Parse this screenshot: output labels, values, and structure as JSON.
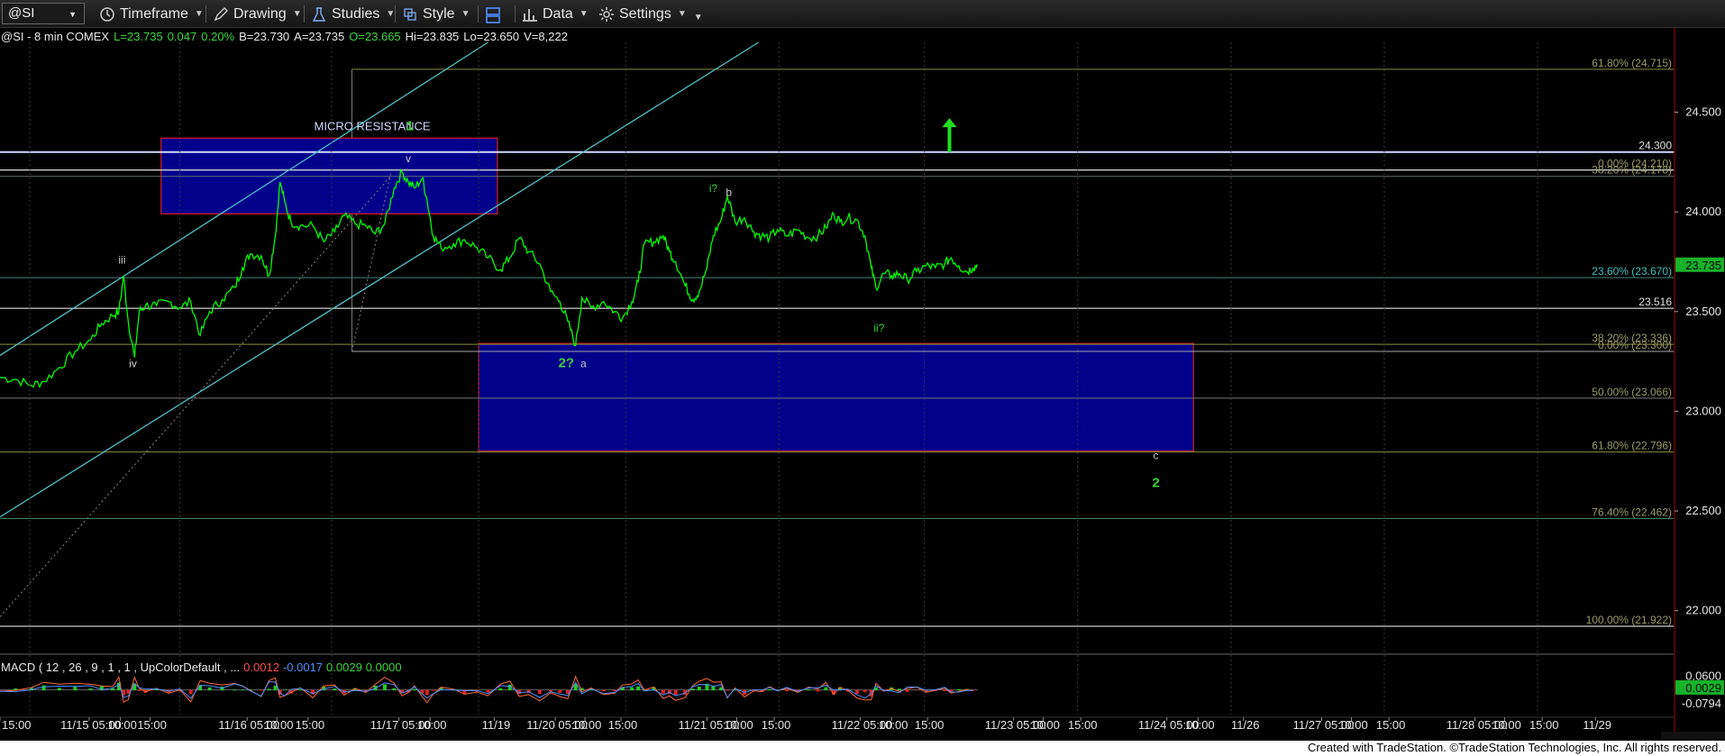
{
  "toolbar": {
    "symbol": "@SI",
    "items": [
      {
        "label": "Timeframe",
        "icon": "clock-icon"
      },
      {
        "label": "Drawing",
        "icon": "pencil-icon"
      },
      {
        "label": "Studies",
        "icon": "flask-icon"
      },
      {
        "label": "Style",
        "icon": "style-icon"
      },
      {
        "label": "",
        "icon": "layout-icon"
      },
      {
        "label": "Data",
        "icon": "bar-chart-icon"
      },
      {
        "label": "Settings",
        "icon": "gear-icon"
      }
    ]
  },
  "header": {
    "symbol": "@SI - 8 min  COMEX",
    "last": "L=23.735",
    "chg": "0.047",
    "pct": "0.20%",
    "bid": "B=23.730",
    "ask": "A=23.735",
    "open": "O=23.665",
    "hi": "Hi=23.835",
    "lo": "Lo=23.650",
    "vol": "V=8,222"
  },
  "macd_header": {
    "title": "MACD ( 12 , 26 , 9 , 1 , 1 , UpColorDefault , ...",
    "v1": "0.0012",
    "v2": "-0.0017",
    "v3": "0.0029",
    "v4": "0.0000"
  },
  "credit": "Created with TradeStation. ©TradeStation Technologies, Inc. All rights reserved.",
  "colors": {
    "price": "#00ff00",
    "box": "#00008b",
    "box_border": "#d02020",
    "channel": "#4fc3c8",
    "fib": "#8a8a40",
    "label_green": "#3bd43b"
  },
  "chart_data": {
    "type": "line",
    "y_axis": {
      "range": [
        21.8,
        24.85
      ],
      "ticks": [
        22.0,
        22.5,
        23.0,
        23.5,
        24.0,
        24.5
      ],
      "tick_labels": [
        "22.000",
        "22.500",
        "23.000",
        "23.500",
        "24.000",
        "24.500"
      ]
    },
    "x_axis": {
      "range": [
        0,
        10.7
      ],
      "ticks": [
        {
          "t": 0.0,
          "label": "15:00"
        },
        {
          "t": 0.57,
          "label": "11/15 05:00"
        },
        {
          "t": 0.77,
          "label": "10:00"
        },
        {
          "t": 0.96,
          "label": "15:00"
        },
        {
          "t": 1.58,
          "label": "11/16 05:00"
        },
        {
          "t": 1.77,
          "label": "10:00"
        },
        {
          "t": 1.97,
          "label": "15:00"
        },
        {
          "t": 2.55,
          "label": "11/17 05:00"
        },
        {
          "t": 2.75,
          "label": "10:00"
        },
        {
          "t": 3.16,
          "label": "11/19"
        },
        {
          "t": 3.55,
          "label": "11/20 05:00"
        },
        {
          "t": 3.74,
          "label": "10:00"
        },
        {
          "t": 3.97,
          "label": "15:00"
        },
        {
          "t": 4.52,
          "label": "11/21 05:00"
        },
        {
          "t": 4.71,
          "label": "10:00"
        },
        {
          "t": 4.95,
          "label": "15:00"
        },
        {
          "t": 5.5,
          "label": "11/22 05:00"
        },
        {
          "t": 5.7,
          "label": "10:00"
        },
        {
          "t": 5.93,
          "label": "15:00"
        },
        {
          "t": 6.48,
          "label": "11/23 05:00"
        },
        {
          "t": 6.67,
          "label": "10:00"
        },
        {
          "t": 6.91,
          "label": "15:00"
        },
        {
          "t": 7.46,
          "label": "11/24 05:00"
        },
        {
          "t": 7.66,
          "label": "10:00"
        },
        {
          "t": 7.95,
          "label": "11/26"
        },
        {
          "t": 8.45,
          "label": "11/27 05:00"
        },
        {
          "t": 8.64,
          "label": "10:00"
        },
        {
          "t": 8.88,
          "label": "15:00"
        },
        {
          "t": 9.43,
          "label": "11/28 05:00"
        },
        {
          "t": 9.62,
          "label": "10:00"
        },
        {
          "t": 9.86,
          "label": "15:00"
        },
        {
          "t": 10.2,
          "label": "11/29"
        }
      ]
    },
    "series": [
      {
        "points": [
          [
            0.0,
            23.17
          ],
          [
            0.1,
            23.16
          ],
          [
            0.2,
            23.13
          ],
          [
            0.28,
            23.15
          ],
          [
            0.38,
            23.22
          ],
          [
            0.48,
            23.3
          ],
          [
            0.58,
            23.36
          ],
          [
            0.65,
            23.44
          ],
          [
            0.72,
            23.48
          ],
          [
            0.76,
            23.5
          ],
          [
            0.79,
            23.68
          ],
          [
            0.82,
            23.45
          ],
          [
            0.86,
            23.27
          ],
          [
            0.89,
            23.5
          ],
          [
            0.93,
            23.53
          ],
          [
            1.0,
            23.53
          ],
          [
            1.08,
            23.55
          ],
          [
            1.15,
            23.52
          ],
          [
            1.22,
            23.55
          ],
          [
            1.28,
            23.38
          ],
          [
            1.34,
            23.5
          ],
          [
            1.42,
            23.56
          ],
          [
            1.5,
            23.62
          ],
          [
            1.55,
            23.72
          ],
          [
            1.6,
            23.79
          ],
          [
            1.67,
            23.78
          ],
          [
            1.72,
            23.68
          ],
          [
            1.76,
            23.88
          ],
          [
            1.79,
            24.15
          ],
          [
            1.82,
            24.05
          ],
          [
            1.86,
            23.95
          ],
          [
            1.92,
            23.93
          ],
          [
            2.0,
            23.93
          ],
          [
            2.07,
            23.85
          ],
          [
            2.14,
            23.9
          ],
          [
            2.2,
            23.98
          ],
          [
            2.27,
            23.94
          ],
          [
            2.34,
            23.93
          ],
          [
            2.4,
            23.89
          ],
          [
            2.46,
            23.94
          ],
          [
            2.52,
            24.12
          ],
          [
            2.57,
            24.2
          ],
          [
            2.61,
            24.15
          ],
          [
            2.65,
            24.12
          ],
          [
            2.7,
            24.17
          ],
          [
            2.73,
            24.06
          ],
          [
            2.77,
            23.88
          ],
          [
            2.82,
            23.82
          ],
          [
            2.9,
            23.84
          ],
          [
            2.97,
            23.86
          ],
          [
            3.05,
            23.82
          ],
          [
            3.12,
            23.77
          ],
          [
            3.2,
            23.71
          ],
          [
            3.26,
            23.77
          ],
          [
            3.32,
            23.87
          ],
          [
            3.38,
            23.8
          ],
          [
            3.45,
            23.74
          ],
          [
            3.52,
            23.6
          ],
          [
            3.58,
            23.55
          ],
          [
            3.63,
            23.45
          ],
          [
            3.68,
            23.33
          ],
          [
            3.72,
            23.57
          ],
          [
            3.78,
            23.52
          ],
          [
            3.86,
            23.55
          ],
          [
            3.93,
            23.5
          ],
          [
            3.98,
            23.47
          ],
          [
            4.04,
            23.55
          ],
          [
            4.08,
            23.65
          ],
          [
            4.12,
            23.84
          ],
          [
            4.18,
            23.85
          ],
          [
            4.24,
            23.88
          ],
          [
            4.28,
            23.8
          ],
          [
            4.32,
            23.75
          ],
          [
            4.38,
            23.63
          ],
          [
            4.43,
            23.56
          ],
          [
            4.47,
            23.6
          ],
          [
            4.52,
            23.72
          ],
          [
            4.56,
            23.88
          ],
          [
            4.61,
            23.96
          ],
          [
            4.65,
            24.08
          ],
          [
            4.7,
            23.95
          ],
          [
            4.76,
            23.97
          ],
          [
            4.82,
            23.9
          ],
          [
            4.87,
            23.88
          ],
          [
            4.92,
            23.87
          ],
          [
            4.97,
            23.91
          ],
          [
            5.03,
            23.88
          ],
          [
            5.1,
            23.91
          ],
          [
            5.17,
            23.87
          ],
          [
            5.23,
            23.88
          ],
          [
            5.28,
            23.92
          ],
          [
            5.33,
            23.99
          ],
          [
            5.37,
            23.95
          ],
          [
            5.42,
            23.97
          ],
          [
            5.48,
            23.96
          ],
          [
            5.53,
            23.88
          ],
          [
            5.57,
            23.72
          ],
          [
            5.6,
            23.62
          ],
          [
            5.65,
            23.69
          ],
          [
            5.7,
            23.68
          ],
          [
            5.75,
            23.69
          ],
          [
            5.8,
            23.66
          ],
          [
            5.86,
            23.7
          ],
          [
            5.92,
            23.73
          ],
          [
            5.98,
            23.72
          ],
          [
            6.04,
            23.74
          ],
          [
            6.08,
            23.77
          ],
          [
            6.13,
            23.73
          ],
          [
            6.18,
            23.7
          ],
          [
            6.22,
            23.72
          ],
          [
            6.25,
            23.735
          ]
        ]
      }
    ],
    "channel_lines": [
      {
        "from": [
          0.0,
          23.28
        ],
        "to": [
          3.12,
          24.85
        ]
      },
      {
        "from": [
          0.0,
          22.47
        ],
        "to": [
          4.85,
          24.85
        ]
      },
      {
        "from": [
          0.0,
          21.97
        ],
        "to": [
          2.5,
          24.18
        ],
        "dotted": true
      }
    ],
    "horizontal_lines": [
      {
        "y": 24.3,
        "label": "24.300",
        "color": "#cfd8ff",
        "width": 2,
        "x0": 0
      },
      {
        "y": 24.21,
        "label": "0.00% (24.210)",
        "color": "#cfcfcf",
        "width": 1.4,
        "x0": 0
      },
      {
        "y": 24.178,
        "label": "38.20% (24.178)",
        "color": "#5f6f6f",
        "width": 1,
        "x0": 0
      },
      {
        "y": 23.67,
        "label": "23.60% (23.670)",
        "color": "#4a7f7f",
        "width": 1,
        "x0": 0
      },
      {
        "y": 23.516,
        "label": "23.516",
        "color": "#bbbbbb",
        "width": 1.4,
        "x0": 0
      },
      {
        "y": 23.336,
        "label": "38.20% (23.336)",
        "color": "#8a8a40",
        "width": 1,
        "x0": 0
      },
      {
        "y": 23.3,
        "label": "0.00% (23.300)",
        "color": "#aaaaaa",
        "width": 1,
        "x0": 2.25
      },
      {
        "y": 23.066,
        "label": "50.00% (23.066)",
        "color": "#777777",
        "width": 1,
        "x0": 0
      },
      {
        "y": 22.796,
        "label": "61.80% (22.796)",
        "color": "#8a8a40",
        "width": 1,
        "x0": 0
      },
      {
        "y": 22.462,
        "label": "76.40% (22.462)",
        "color": "#3f7f5f",
        "width": 1,
        "x0": 0
      },
      {
        "y": 21.922,
        "label": "100.00% (21.922)",
        "color": "#cccccc",
        "width": 1.2,
        "x0": 0
      },
      {
        "y": 24.715,
        "label": "61.80% (24.715)",
        "color": "#8a8a40",
        "width": 1,
        "x0": 2.25
      }
    ],
    "boxes": [
      {
        "x0": 1.03,
        "x1": 3.18,
        "y0": 23.99,
        "y1": 24.37
      },
      {
        "x0": 3.06,
        "x1": 7.63,
        "y0": 22.8,
        "y1": 23.34
      }
    ],
    "annotations": [
      {
        "x": 2.38,
        "y": 24.41,
        "text": "MICRO RESISTANCE",
        "color": "#cfd8ff",
        "size": 13
      },
      {
        "x": 2.62,
        "y": 24.41,
        "text": "1",
        "color": "#3bd43b",
        "size": 15,
        "bold": true
      },
      {
        "x": 2.61,
        "y": 24.25,
        "text": "v",
        "color": "#cccccc",
        "size": 12
      },
      {
        "x": 0.78,
        "y": 23.74,
        "text": "iii",
        "color": "#cccccc",
        "size": 12
      },
      {
        "x": 0.85,
        "y": 23.22,
        "text": "iv",
        "color": "#cccccc",
        "size": 12
      },
      {
        "x": 3.62,
        "y": 23.22,
        "text": "2?",
        "color": "#3bd43b",
        "size": 15,
        "bold": true
      },
      {
        "x": 3.73,
        "y": 23.22,
        "text": "a",
        "color": "#cccccc",
        "size": 12
      },
      {
        "x": 4.56,
        "y": 24.1,
        "text": "i?",
        "color": "#3bd43b",
        "size": 12
      },
      {
        "x": 4.66,
        "y": 24.08,
        "text": "b",
        "color": "#cccccc",
        "size": 12
      },
      {
        "x": 5.62,
        "y": 23.4,
        "text": "ii?",
        "color": "#3bd43b",
        "size": 12
      },
      {
        "x": 7.39,
        "y": 22.76,
        "text": "c",
        "color": "#cccccc",
        "size": 12
      },
      {
        "x": 7.39,
        "y": 22.62,
        "text": "2",
        "color": "#3bd43b",
        "size": 15,
        "bold": true
      }
    ],
    "up_arrow": {
      "x": 6.07,
      "y_from": 24.3,
      "y_to": 24.47
    },
    "last_price_tag": "23.735",
    "vertical_dotted_t": [
      0.19,
      1.15,
      2.12,
      3.06,
      4.0,
      4.98,
      5.91,
      6.89,
      7.87,
      8.85,
      9.83
    ],
    "vertical_marker_t": [
      2.25
    ],
    "macd": {
      "y_range": [
        -0.11,
        0.095
      ],
      "ticks": [
        {
          "v": 0.06,
          "label": "0.0600"
        }
      ],
      "readouts": [
        {
          "v": 0.0029,
          "label": "0.0029",
          "box": true
        },
        {
          "v": -0.0794,
          "label": "-0.0794"
        }
      ]
    }
  }
}
